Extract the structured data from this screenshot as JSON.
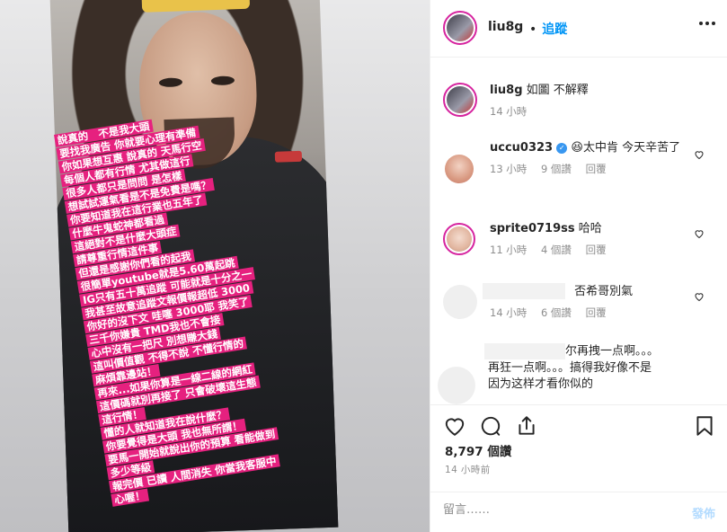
{
  "story_overlay": [
    "說真的　不是我大頭",
    "要找我廣告 你就要心理有準備",
    "你如果想互惠 說真的 天馬行空",
    "每個人都有行情 尤其做這行",
    "很多人都只是問問 是怎樣",
    "想試試運氣看是不是免費是嗎？",
    "你要知道我在這行業也五年了",
    "什麼牛鬼蛇神都看過",
    "這絕對不是什麼大頭症",
    "請尊重行情這件事",
    "但還是感謝你們看的起我",
    "很簡單youtube就是5.60萬起跳",
    "IG只有五十萬追蹤 可能就是十分之一",
    "我甚至故意追蹤文報價報超低 3000",
    "你好的沒下文 哇噻 3000耶 我笑了",
    "三千你嫌貴 TMD我也不會接",
    "心中沒有一把尺 別想賺大錢",
    "這叫價值觀 不得不說 不懂行情的",
    "麻煩靠邊站！",
    "再來...如果你算是一線二線的網紅",
    "這價碼就別再接了 只會破壞這生態",
    "這行情！",
    "懂的人就知道我在說什麼？",
    "你要覺得是大頭 我也無所謂！",
    "要馬一開始就說出你的預算 看能做到",
    "多少等級",
    "報完價 已讀 人間消失 你當我客服中",
    "心喔！"
  ],
  "header": {
    "username": "liu8g",
    "separator": "•",
    "follow_label": "追蹤"
  },
  "caption": {
    "username": "liu8g",
    "text": "如圖 不解釋",
    "time": "14 小時"
  },
  "comments": [
    {
      "username": "uccu0323",
      "verified": true,
      "text": "😆太中肯 今天辛苦了",
      "time": "13 小時",
      "likes": "9 個讚",
      "reply": "回覆"
    },
    {
      "username": "sprite0719ss",
      "text": "哈哈",
      "time": "11 小時",
      "likes": "4 個讚",
      "reply": "回覆"
    },
    {
      "username": "",
      "text": "否希哥別氣",
      "time": "14 小時",
      "likes": "6 個讚",
      "reply": "回覆"
    },
    {
      "username": "",
      "text_line1": "尔再拽一点啊。。。",
      "text_line2": "再狂一点啊。。。搞得我好像不是",
      "text_line3": "因为这样才看你似的"
    }
  ],
  "likes_label": "8,797 個讚",
  "post_time": "14 小時前",
  "comment_input": {
    "placeholder": "留言……"
  },
  "post_label": "發佈",
  "colors": {
    "accent": "#0095f6",
    "overlay": "#e6217f",
    "post_disabled": "#b3dbff"
  }
}
